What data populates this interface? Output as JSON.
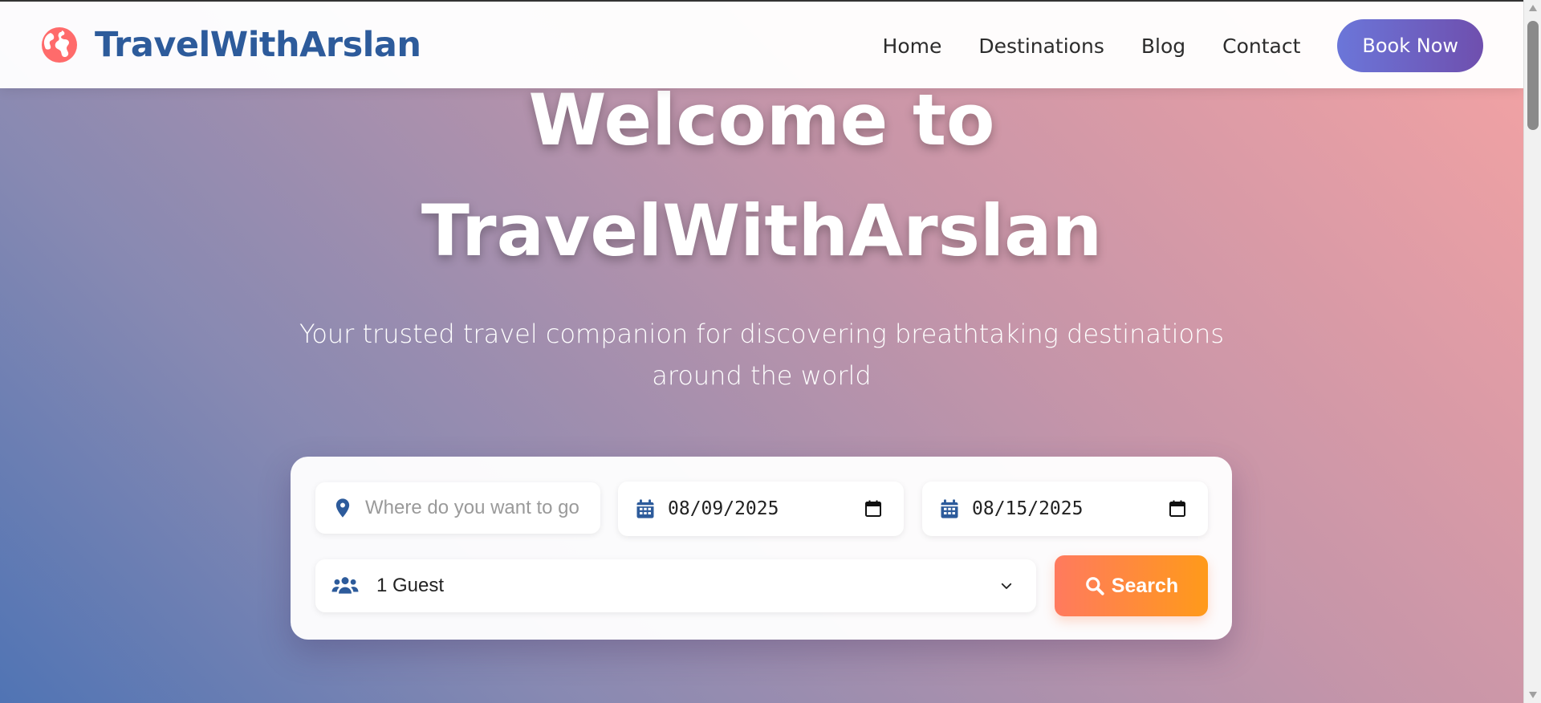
{
  "brand": {
    "name": "TravelWithArslan",
    "icon": "globe-icon"
  },
  "nav": {
    "links": [
      "Home",
      "Destinations",
      "Blog",
      "Contact"
    ],
    "cta_label": "Book Now"
  },
  "hero": {
    "title_line1": "Welcome to",
    "title_line2": "TravelWithArslan",
    "subtitle": "Your trusted travel companion for discovering breathtaking destinations around the world"
  },
  "search": {
    "destination_placeholder": "Where do you want to go",
    "checkin_value": "08/09/2025",
    "checkout_value": "08/15/2025",
    "guests_value": "1 Guest",
    "button_label": "Search"
  },
  "colors": {
    "brand_blue": "#2d5b9b",
    "accent_coral": "#ff6b6b",
    "cta_gradient_start": "#6b76d9",
    "cta_gradient_end": "#6f4fae",
    "search_gradient_start": "#ff7a5e",
    "search_gradient_end": "#ff9a1a"
  }
}
